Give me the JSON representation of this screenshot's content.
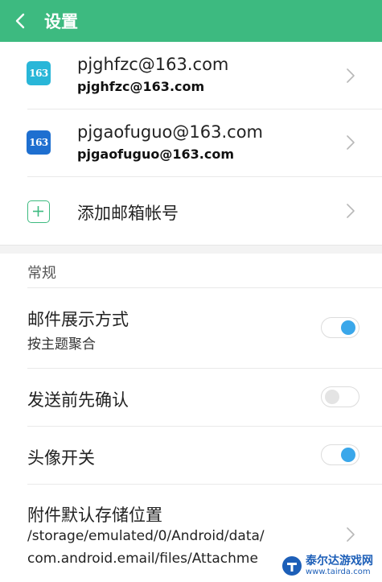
{
  "header": {
    "title": "设置"
  },
  "accounts": [
    {
      "icon_label": "163",
      "icon_color": "#29b6d8",
      "address": "pjghfzc@163.com",
      "display": "pjghfzc@163.com"
    },
    {
      "icon_label": "163",
      "icon_color": "#1e6fd0",
      "address": "pjgaofuguo@163.com",
      "display": "pjgaofuguo@163.com"
    }
  ],
  "add_account": {
    "label": "添加邮箱帐号",
    "icon": "plus-icon"
  },
  "general": {
    "section_label": "常规",
    "mail_display": {
      "title": "邮件展示方式",
      "value": "按主题聚合",
      "enabled": true
    },
    "confirm_send": {
      "title": "发送前先确认",
      "enabled": false
    },
    "avatar": {
      "title": "头像开关",
      "enabled": true
    },
    "attachment_location": {
      "title": "附件默认存储位置",
      "path_line1": "/storage/emulated/0/Android/data/",
      "path_line2": "com.android.email/files/Attachme"
    }
  },
  "watermark": {
    "name": "泰尔达游戏网",
    "url": "www.tairda.com"
  },
  "colors": {
    "header": "#3dba80",
    "toggle_on": "#3aa7ea",
    "add_icon": "#3dba80"
  }
}
